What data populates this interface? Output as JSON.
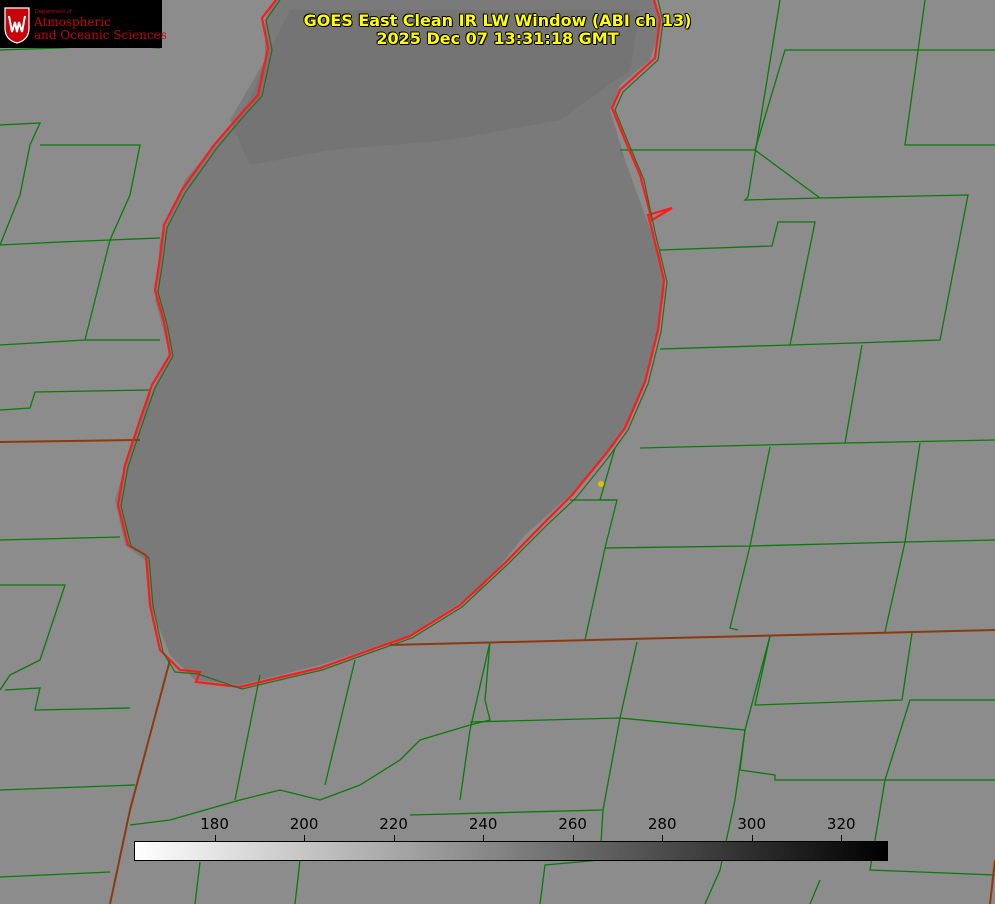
{
  "header": {
    "title_line1": "GOES East Clean IR LW Window (ABI ch 13)",
    "title_line2": "2025 Dec 07 13:31:18 GMT"
  },
  "logo": {
    "department": "Department of",
    "line1": "Atmospheric",
    "line2": "and Oceanic Sciences",
    "icon": "uw-crest-icon"
  },
  "colorbar": {
    "ticks": [
      "180",
      "200",
      "220",
      "240",
      "260",
      "280",
      "300",
      "320"
    ],
    "range": [
      162,
      330
    ],
    "colormap": "white-to-black"
  },
  "colors": {
    "background": "#8a8a8a",
    "county_lines": "#0a7a0a",
    "lake_outline": "#ff2020",
    "state_lines": "#8b3a10",
    "title": "#ffff00",
    "marker": "#e0c000"
  },
  "map": {
    "feature": "lake-outline",
    "marker": "location-marker"
  }
}
